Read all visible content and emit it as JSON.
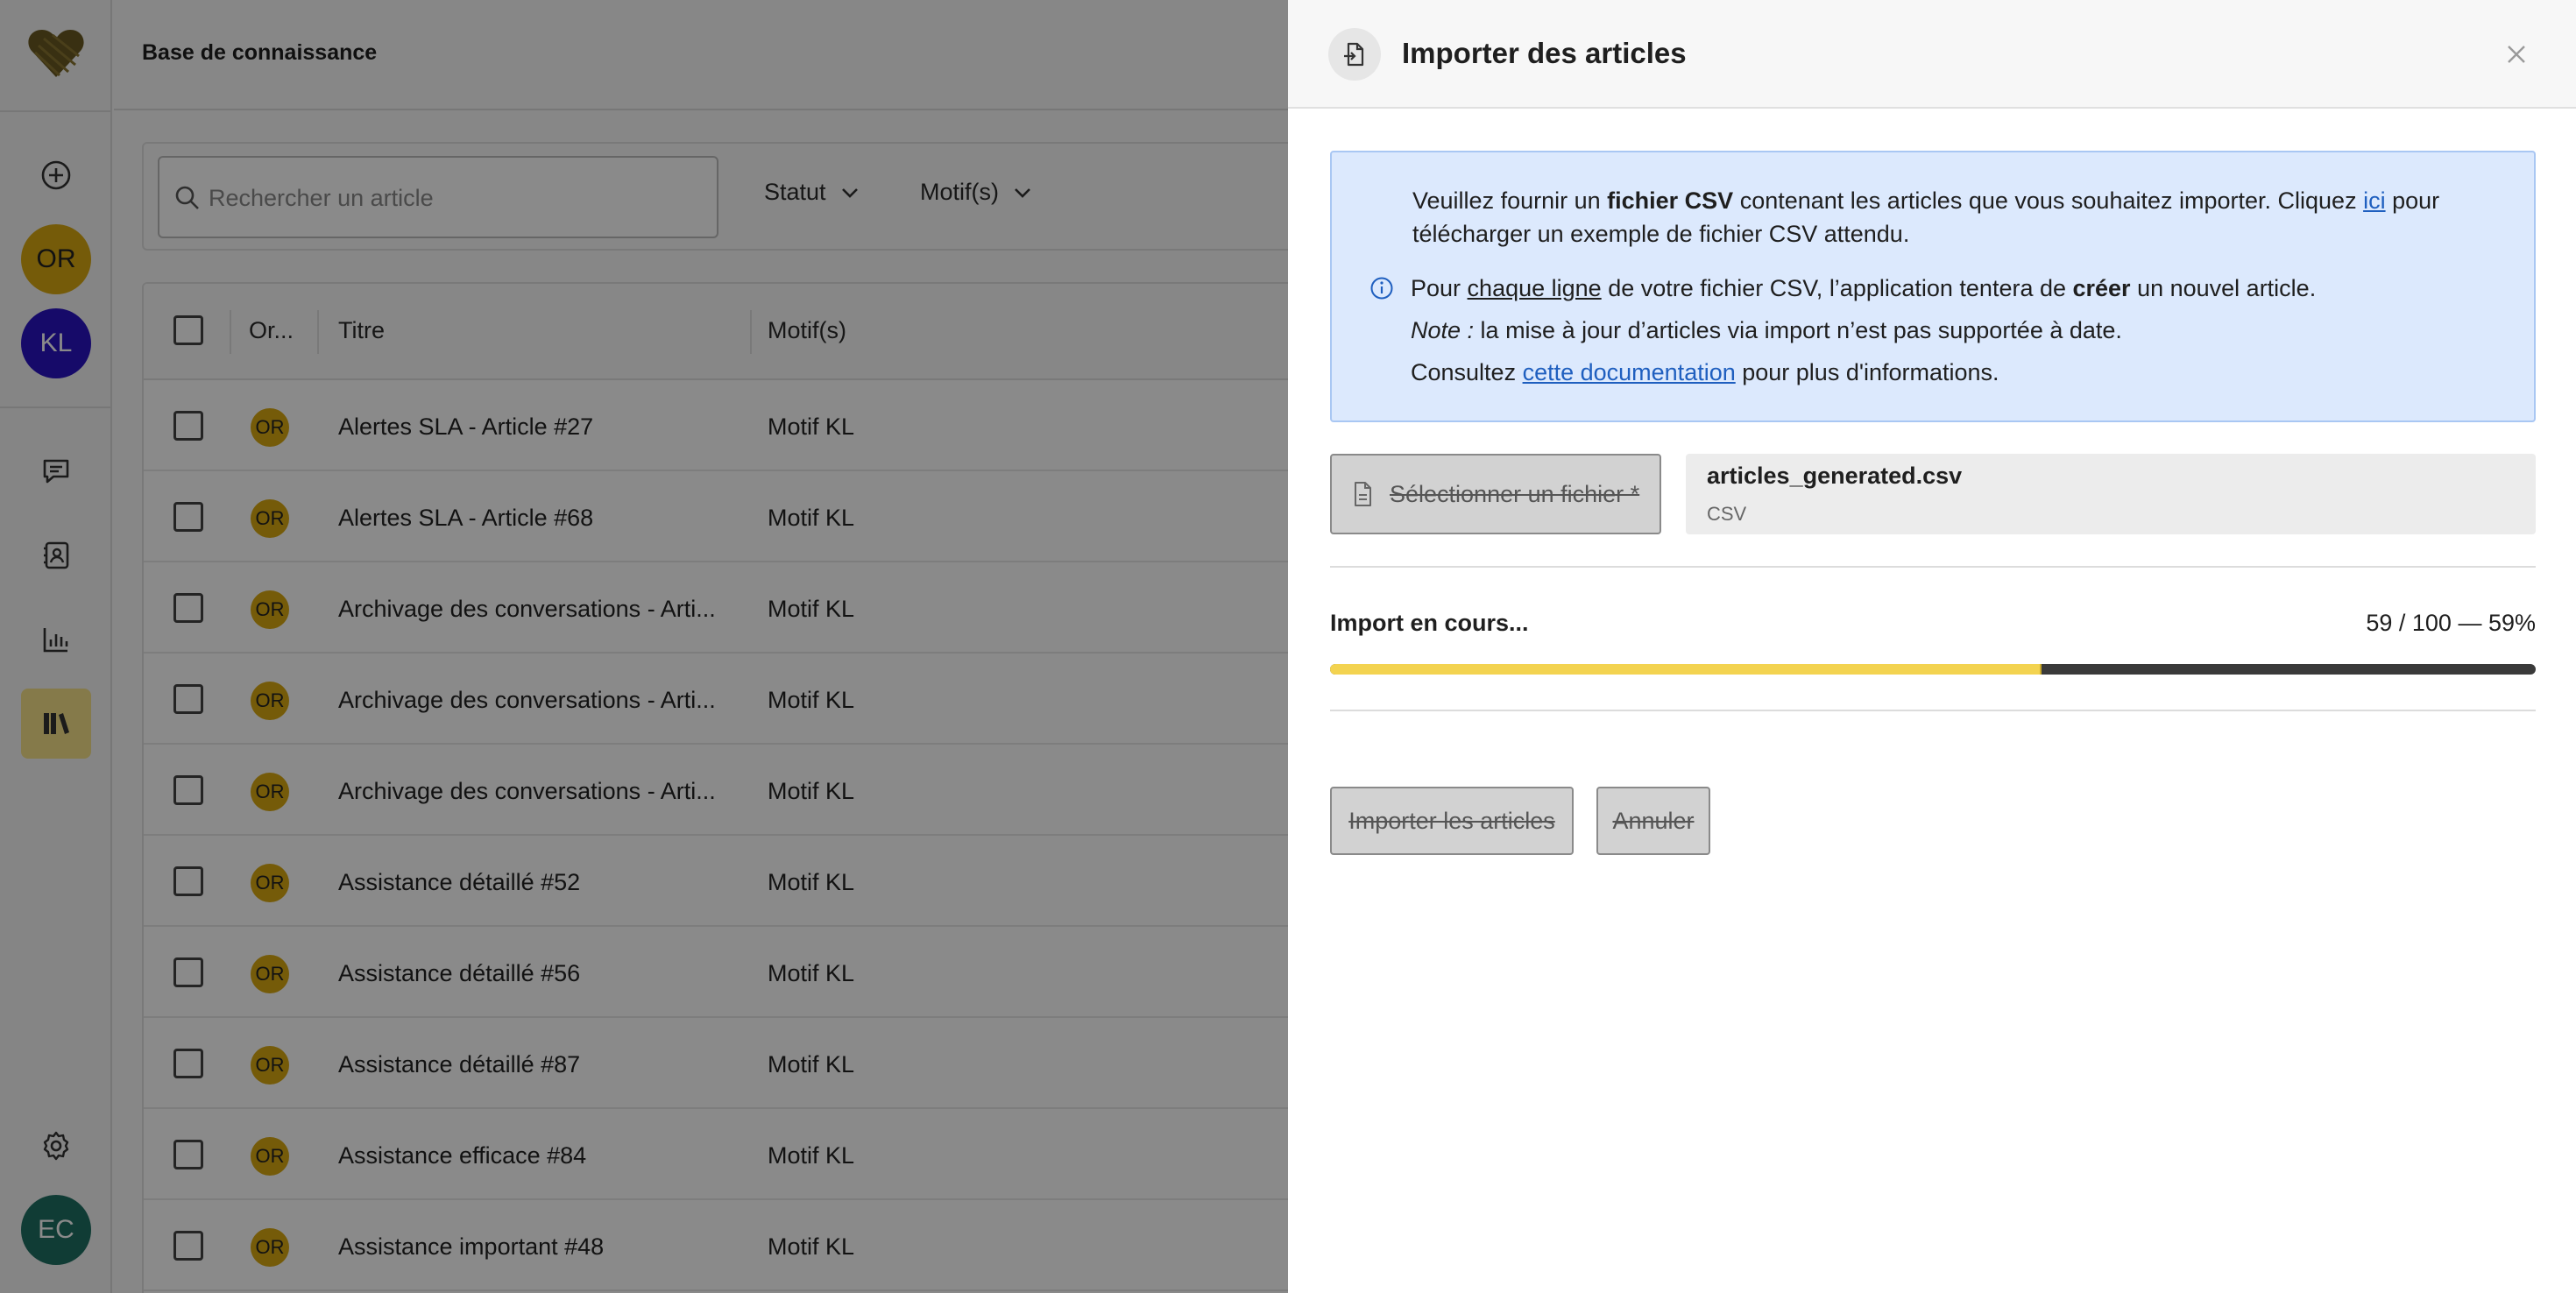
{
  "topbar": {
    "title": "Base de connaissance"
  },
  "rail": {
    "avatars": [
      {
        "initials": "OR",
        "bg": "#d9a911",
        "fg": "#222222"
      },
      {
        "initials": "KL",
        "bg": "#2a14c2",
        "fg": "#ffffff"
      }
    ],
    "user": {
      "initials": "EC",
      "bg": "#1f6f62",
      "fg": "#ffffff"
    },
    "icons": [
      "add-circle-icon",
      "chat-icon",
      "contacts-icon",
      "bar-chart-icon",
      "library-icon",
      "gear-icon"
    ]
  },
  "filters": {
    "search_placeholder": "Rechercher un article",
    "status_label": "Statut",
    "motifs_label": "Motif(s)"
  },
  "table": {
    "columns": [
      "Or...",
      "Titre",
      "Motif(s)"
    ],
    "rows": [
      {
        "org": "OR",
        "title": "Alertes SLA - Article #27",
        "motif": "Motif KL"
      },
      {
        "org": "OR",
        "title": "Alertes SLA - Article #68",
        "motif": "Motif KL"
      },
      {
        "org": "OR",
        "title": "Archivage des conversations - Arti...",
        "motif": "Motif KL"
      },
      {
        "org": "OR",
        "title": "Archivage des conversations - Arti...",
        "motif": "Motif KL"
      },
      {
        "org": "OR",
        "title": "Archivage des conversations - Arti...",
        "motif": "Motif KL"
      },
      {
        "org": "OR",
        "title": "Assistance détaillé #52",
        "motif": "Motif KL"
      },
      {
        "org": "OR",
        "title": "Assistance détaillé #56",
        "motif": "Motif KL"
      },
      {
        "org": "OR",
        "title": "Assistance détaillé #87",
        "motif": "Motif KL"
      },
      {
        "org": "OR",
        "title": "Assistance efficace #84",
        "motif": "Motif KL"
      },
      {
        "org": "OR",
        "title": "Assistance important #48",
        "motif": "Motif KL"
      }
    ]
  },
  "drawer": {
    "title": "Importer des articles",
    "info": {
      "p1_a": "Veuillez fournir un ",
      "p1_b": "fichier CSV",
      "p1_c": " contenant les articles que vous souhaitez importer. Cliquez ",
      "p1_link": "ici",
      "p1_d": " pour",
      "p1_e": "télécharger un exemple de fichier CSV attendu.",
      "p2_a": "Pour ",
      "p2_u": "chaque ligne",
      "p2_b": " de votre fichier CSV, l’application tentera de ",
      "p2_c": "créer",
      "p2_d": " un nouvel article.",
      "p3_a": "Note :",
      "p3_b": " la mise à jour d’articles via import n’est pas supportée à date.",
      "p4_a": "Consultez ",
      "p4_link": "cette documentation",
      "p4_b": " pour plus d'informations."
    },
    "file_button_label": "Sélectionner un fichier *",
    "file": {
      "name": "articles_generated.csv",
      "type": "CSV"
    },
    "progress": {
      "label": "Import en cours...",
      "text": "59 / 100 — 59%",
      "done": 59,
      "total": 100,
      "fraction": 0.59
    },
    "buttons": {
      "import": "Importer les articles",
      "cancel": "Annuler"
    }
  },
  "colors": {
    "accent": "#f3d350",
    "info_bg": "#dce9fd",
    "link": "#1f5fbf",
    "org_badge": "#d9a911"
  }
}
